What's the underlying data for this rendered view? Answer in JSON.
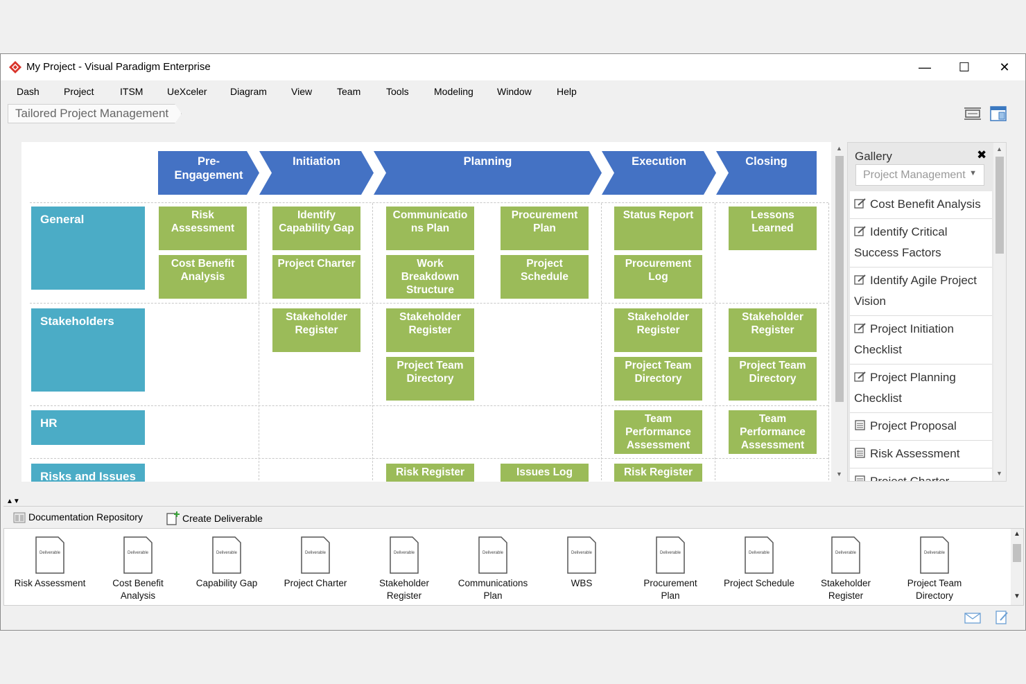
{
  "window": {
    "title": "My Project - Visual Paradigm Enterprise",
    "controls": [
      "—",
      "☐",
      "✕"
    ]
  },
  "menubar": [
    "Dash",
    "Project",
    "ITSM",
    "UeXceler",
    "Diagram",
    "View",
    "Team",
    "Tools",
    "Modeling",
    "Window",
    "Help"
  ],
  "breadcrumb": "Tailored Project Management",
  "phases": [
    "Pre-\nEngagement",
    "Initiation",
    "Planning",
    "Execution",
    "Closing"
  ],
  "lanes": [
    "General",
    "Stakeholders",
    "HR",
    "Risks and Issues"
  ],
  "cards": {
    "general": [
      "Risk\nAssessment",
      "Cost Benefit\nAnalysis",
      "Identify\nCapability Gap",
      "Project Charter",
      "Communicatio\nns Plan",
      "Work\nBreakdown\nStructure",
      "Procurement\nPlan",
      "Project\nSchedule",
      "Status Report",
      "Procurement\nLog",
      "Lessons\nLearned"
    ],
    "stakeholders": [
      "Stakeholder\nRegister",
      "Stakeholder\nRegister",
      "Project Team\nDirectory",
      "Stakeholder\nRegister",
      "Project Team\nDirectory",
      "Stakeholder\nRegister",
      "Project Team\nDirectory"
    ],
    "hr": [
      "Team\nPerformance\nAssessment",
      "Team\nPerformance\nAssessment"
    ],
    "risks": [
      "Risk Register",
      "Issues Log",
      "Risk Register"
    ]
  },
  "gallery": {
    "title": "Gallery",
    "close": "✖",
    "filter": "Project Management",
    "items": [
      {
        "label": "Cost Benefit Analysis",
        "icon": "edit-icon"
      },
      {
        "label": "Identify Critical Success Factors",
        "icon": "edit-icon"
      },
      {
        "label": "Identify Agile Project Vision",
        "icon": "edit-icon"
      },
      {
        "label": "Project Initiation Checklist",
        "icon": "edit-icon"
      },
      {
        "label": "Project Planning Checklist",
        "icon": "edit-icon"
      },
      {
        "label": "Project Proposal",
        "icon": "table-doc-icon"
      },
      {
        "label": "Risk Assessment",
        "icon": "table-doc-icon"
      },
      {
        "label": "Project Charter",
        "icon": "table-doc-icon"
      }
    ]
  },
  "bottom_toolbar": {
    "repository": "Documentation Repository",
    "create": "Create Deliverable"
  },
  "deliverable_icon_text": "Deliverable",
  "deliverables": [
    "Risk Assessment",
    "Cost Benefit\nAnalysis",
    "Capability Gap",
    "Project Charter",
    "Stakeholder\nRegister",
    "Communications\nPlan",
    "WBS",
    "Procurement\nPlan",
    "Project Schedule",
    "Stakeholder\nRegister",
    "Project Team\nDirectory"
  ],
  "colors": {
    "phase": "#4472c4",
    "lane": "#4bacc6",
    "card": "#9bbb59",
    "logo": "#d9342b"
  }
}
